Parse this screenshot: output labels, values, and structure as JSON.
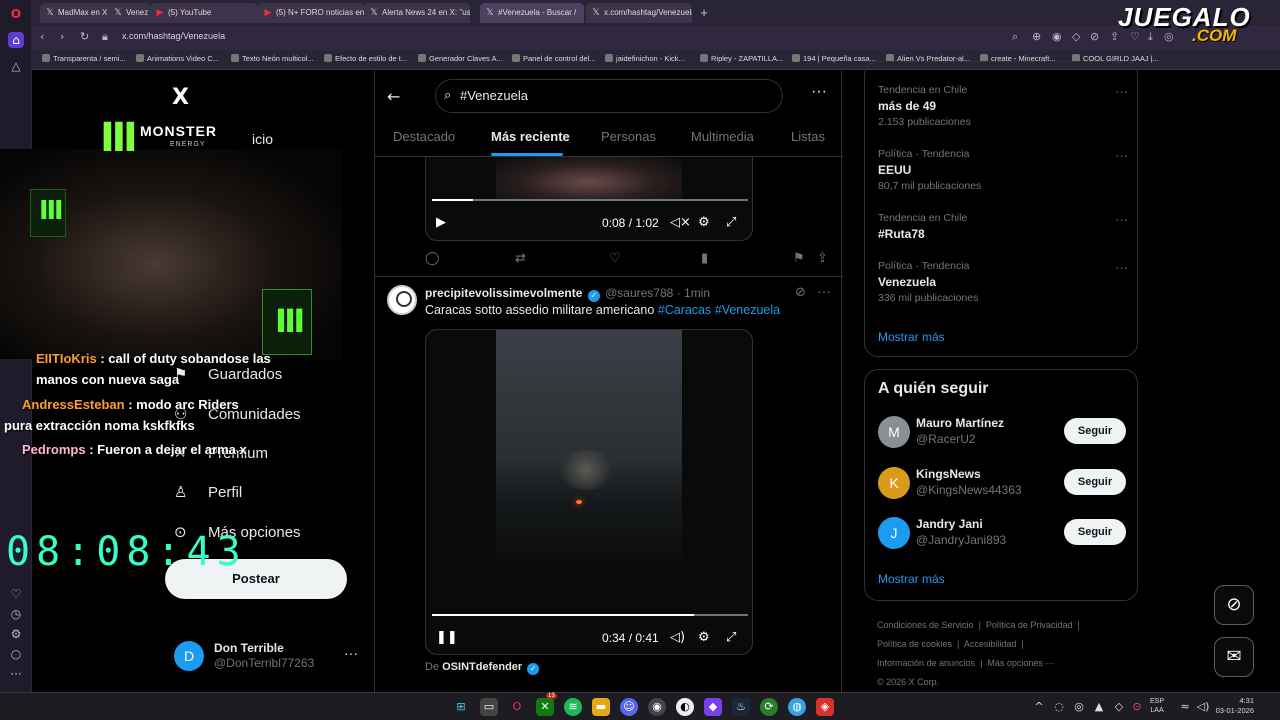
{
  "browser": {
    "tabs": [
      {
        "label": "MadMax en X: \"",
        "icon": "x-icon"
      },
      {
        "label": "Venez",
        "icon": "x-icon"
      },
      {
        "label": "(5) YouTube",
        "icon": "youtube-icon"
      },
      {
        "label": "(5) N+ FORO noticias en",
        "icon": "youtube-icon"
      },
      {
        "label": "Alerta News 24 en X: \"us",
        "icon": "x-icon"
      },
      {
        "label": "#Venezuela - Buscar /",
        "icon": "x-icon"
      },
      {
        "label": "x.com/hashtag/Venezuela",
        "icon": "x-icon"
      }
    ],
    "url": "x.com/hashtag/Venezuela",
    "bookmarks": [
      "Transparenta / semi...",
      "Animations Video C...",
      "Texto Neón multicol...",
      "Efecto de estilo de t...",
      "Generador Claves A...",
      "Panel de control del...",
      "jaidefinichon - Kick...",
      "Ripley - ZAPATILLA...",
      "194 | Pequeña casa...",
      "Alien Vs Predator-al...",
      "create - Minecraft...",
      "COOL GIRLD JAAJ |..."
    ]
  },
  "overlay_logo": {
    "line1": "JUEGALO",
    "line2": ".COM"
  },
  "monster": {
    "brand": "MONSTER",
    "sub": "ENERGY",
    "behind_text": "icio"
  },
  "nav": {
    "x_logo": "X",
    "items": [
      {
        "label": "Guardados",
        "icon": "bookmark-icon"
      },
      {
        "label": "Comunidades",
        "icon": "communities-icon"
      },
      {
        "label": "Premium",
        "icon": "x-premium-icon"
      },
      {
        "label": "Perfil",
        "icon": "profile-icon"
      },
      {
        "label": "Más opciones",
        "icon": "more-options-icon"
      }
    ],
    "post_button": "Postear",
    "account": {
      "initial": "D",
      "name": "Don Terrible",
      "handle": "@DonTerribl77263"
    }
  },
  "chat": [
    {
      "user": "EIITIoKris",
      "message": ": call of duty sobandose las"
    },
    {
      "user": "",
      "message": "manos con nueva saga"
    },
    {
      "user": "AndressEsteban",
      "message": ": modo arc Riders"
    },
    {
      "user": "",
      "message": "pura extracción noma kskfkfks"
    },
    {
      "user": "Pedromps",
      "message": ": Fueron a dejar el arma x"
    }
  ],
  "stream_clock": "08:08:43",
  "search": {
    "query": "#Venezuela"
  },
  "tabs": [
    "Destacado",
    "Más reciente",
    "Personas",
    "Multimedia",
    "Listas"
  ],
  "post1": {
    "time": "0:08 / 1:02",
    "progress": 0.13
  },
  "post2": {
    "name": "precipitevolissimevolmente",
    "handle": "@saures788",
    "time": "1min",
    "text": "Caracas sotto assedio militare americano",
    "hashtags": [
      "#Caracas",
      "#Venezuela"
    ],
    "video_time": "0:34 / 0:41",
    "progress": 0.83,
    "source_prefix": "De",
    "source": "OSINTdefender"
  },
  "trends": [
    {
      "category": "Tendencia en Chile",
      "name": "más de 49",
      "count": "2.153 publicaciones"
    },
    {
      "category": "Política · Tendencia",
      "name": "EEUU",
      "count": "80,7 mil publicaciones"
    },
    {
      "category": "Tendencia en Chile",
      "name": "#Ruta78",
      "count": ""
    },
    {
      "category": "Política · Tendencia",
      "name": "Venezuela",
      "count": "336 mil publicaciones"
    }
  ],
  "show_more": "Mostrar más",
  "who_to_follow": {
    "title": "A quién seguir",
    "button": "Seguir",
    "users": [
      {
        "name": "Mauro Martínez",
        "handle": "@RacerU2",
        "initial": "M",
        "color": "#8a8f94"
      },
      {
        "name": "KingsNews",
        "handle": "@KingsNews44363",
        "initial": "K",
        "color": "#d99b1c"
      },
      {
        "name": "Jandry Jani",
        "handle": "@JandryJani893",
        "initial": "J",
        "color": "#1d9bf0"
      }
    ]
  },
  "footer": [
    "Condiciones de Servicio",
    "Política de Privacidad",
    "Política de cookies",
    "Accesibilidad",
    "Información de anuncios",
    "Más opciones ···",
    "© 2026 X Corp."
  ],
  "taskbar": {
    "lang1": "ESP",
    "lang2": "LAA",
    "time": "4:31",
    "date": "03-01-2026",
    "badge": "13"
  },
  "colors": {
    "accent": "#1d9bf0",
    "background": "#000000",
    "border": "#2f3336"
  }
}
